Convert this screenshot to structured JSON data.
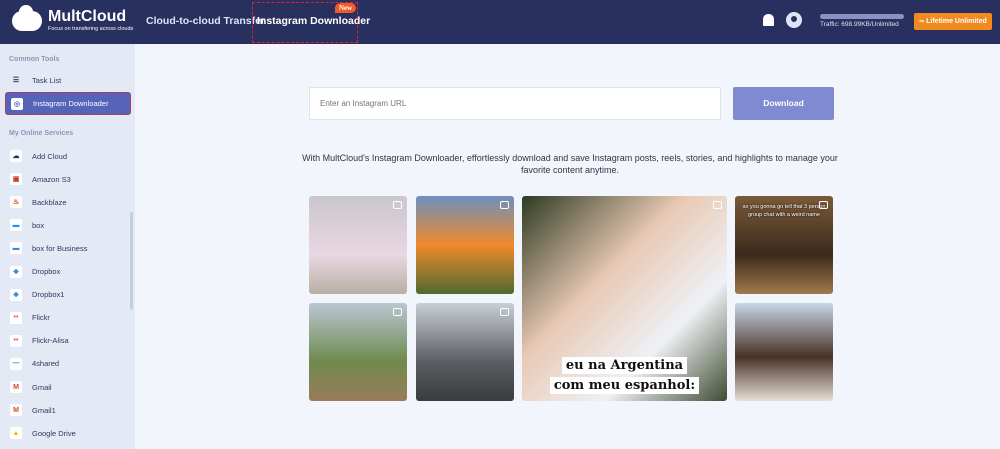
{
  "header": {
    "logo_name": "MultCloud",
    "logo_tagline": "Focus on transfering across clouds",
    "nav": [
      "Cloud-to-cloud Transfer",
      "Instagram Downloader"
    ],
    "new_badge": "New",
    "traffic": "Traffic: 698.99KB/Unlimited",
    "lifetime_button": "Lifetime Unlimited"
  },
  "sidebar": {
    "common_tools_title": "Common Tools",
    "common_tools": [
      "Task List",
      "Instagram Downloader"
    ],
    "services_title": "My Online Services",
    "services": [
      "Add Cloud",
      "Amazon S3",
      "Backblaze",
      "box",
      "box for Business",
      "Dropbox",
      "Dropbox1",
      "Flickr",
      "Flickr-Alisa",
      "4shared",
      "Gmail",
      "Gmail1",
      "Google Drive"
    ]
  },
  "main": {
    "url_placeholder": "Enter an Instagram URL",
    "download_button": "Download",
    "description": "With MultCloud's Instagram Downloader, effortlessly download and save Instagram posts, reels, stories, and highlights to manage your favorite content anytime.",
    "big_caption_1": "eu na Argentina",
    "big_caption_2": "com meu espanhol:",
    "small_caption": "so you gonna go tell that 3 person group chat with a weird name"
  }
}
